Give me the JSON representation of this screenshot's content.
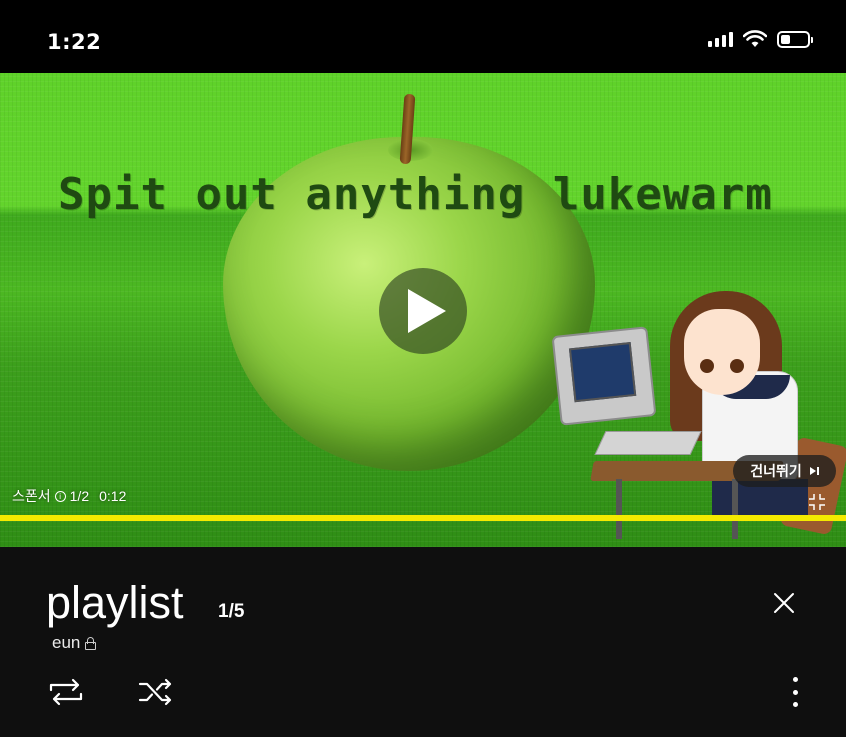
{
  "status_bar": {
    "time": "1:22",
    "icons": [
      "signal-icon",
      "wifi-icon",
      "battery-icon"
    ],
    "battery_level": 0.35
  },
  "video": {
    "overlay_text": "Spit out anything lukewarm",
    "sponsor_label": "스폰서",
    "ad_position": "1/2",
    "ad_time": "0:12",
    "skip_label": "건너뛰기",
    "progress_color": "#f4ea00",
    "background_color": "#5fd22a"
  },
  "playlist": {
    "title": "playlist",
    "count": "1/5",
    "owner": "eun"
  },
  "controls": {
    "icons": [
      "loop-icon",
      "shuffle-icon",
      "more-icon",
      "close-icon"
    ]
  }
}
